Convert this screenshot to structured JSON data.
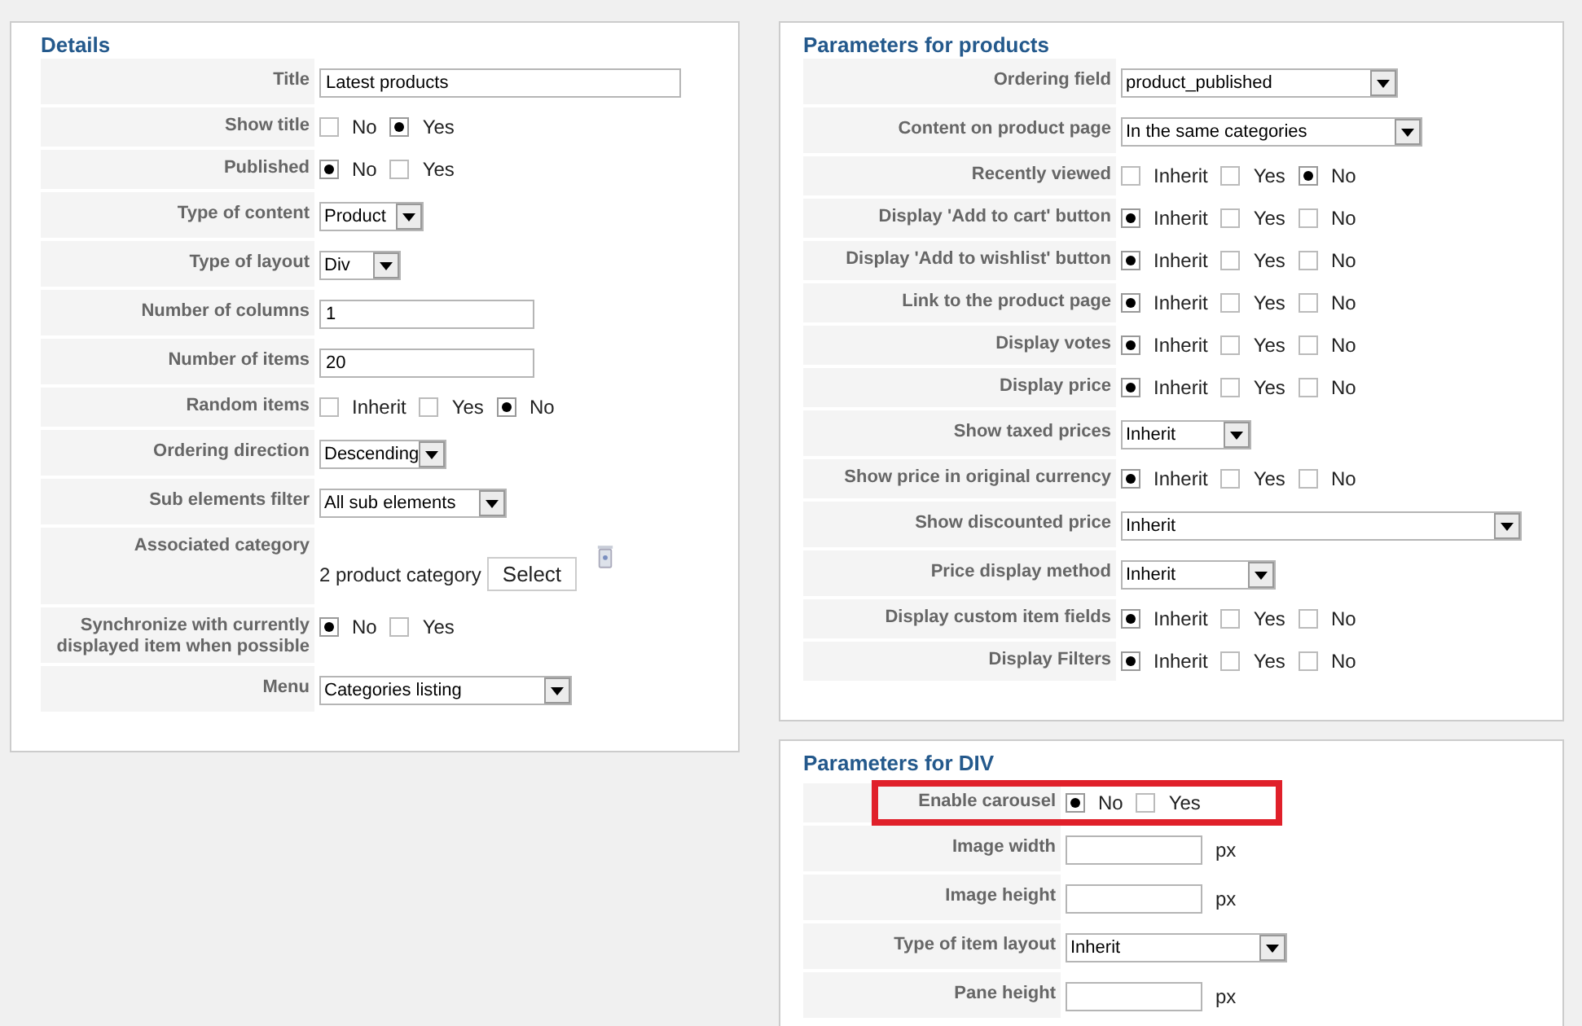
{
  "sections": [
    {
      "title": "Details",
      "rows": [
        {
          "kind": "text",
          "label": "Title",
          "value": "Latest products"
        },
        {
          "kind": "radio",
          "label": "Show title",
          "options": [
            {
              "label": "No",
              "selected": false
            },
            {
              "label": "Yes",
              "selected": true
            }
          ]
        },
        {
          "kind": "radio",
          "label": "Published",
          "options": [
            {
              "label": "No",
              "selected": true
            },
            {
              "label": "Yes",
              "selected": false
            }
          ]
        },
        {
          "kind": "select",
          "label": "Type of content",
          "value": "Product"
        },
        {
          "kind": "select",
          "label": "Type of layout",
          "value": "Div"
        },
        {
          "kind": "text",
          "label": "Number of columns",
          "value": "1"
        },
        {
          "kind": "text",
          "label": "Number of items",
          "value": "20"
        },
        {
          "kind": "radio",
          "label": "Random items",
          "options": [
            {
              "label": "Inherit",
              "selected": false
            },
            {
              "label": "Yes",
              "selected": false
            },
            {
              "label": "No",
              "selected": true
            }
          ]
        },
        {
          "kind": "select",
          "label": "Ordering direction",
          "value": "Descending"
        },
        {
          "kind": "select",
          "label": "Sub elements filter",
          "value": "All sub elements"
        },
        {
          "kind": "category",
          "label": "Associated category",
          "value": "2 product category",
          "button": "Select"
        },
        {
          "kind": "radio",
          "label": "Synchronize with currently displayed item when possible",
          "options": [
            {
              "label": "No",
              "selected": true
            },
            {
              "label": "Yes",
              "selected": false
            }
          ]
        },
        {
          "kind": "select",
          "label": "Menu",
          "value": "Categories listing"
        }
      ]
    },
    {
      "title": "Parameters for products",
      "rows": [
        {
          "kind": "select",
          "label": "Ordering field",
          "value": "product_published"
        },
        {
          "kind": "select",
          "label": "Content on product page",
          "value": "In the same categories"
        },
        {
          "kind": "radio",
          "label": "Recently viewed",
          "options": [
            {
              "label": "Inherit",
              "selected": false
            },
            {
              "label": "Yes",
              "selected": false
            },
            {
              "label": "No",
              "selected": true
            }
          ]
        },
        {
          "kind": "radio",
          "label": "Display 'Add to cart' button",
          "options": [
            {
              "label": "Inherit",
              "selected": true
            },
            {
              "label": "Yes",
              "selected": false
            },
            {
              "label": "No",
              "selected": false
            }
          ]
        },
        {
          "kind": "radio",
          "label": "Display 'Add to wishlist' button",
          "options": [
            {
              "label": "Inherit",
              "selected": true
            },
            {
              "label": "Yes",
              "selected": false
            },
            {
              "label": "No",
              "selected": false
            }
          ]
        },
        {
          "kind": "radio",
          "label": "Link to the product page",
          "options": [
            {
              "label": "Inherit",
              "selected": true
            },
            {
              "label": "Yes",
              "selected": false
            },
            {
              "label": "No",
              "selected": false
            }
          ]
        },
        {
          "kind": "radio",
          "label": "Display votes",
          "options": [
            {
              "label": "Inherit",
              "selected": true
            },
            {
              "label": "Yes",
              "selected": false
            },
            {
              "label": "No",
              "selected": false
            }
          ]
        },
        {
          "kind": "radio",
          "label": "Display price",
          "options": [
            {
              "label": "Inherit",
              "selected": true
            },
            {
              "label": "Yes",
              "selected": false
            },
            {
              "label": "No",
              "selected": false
            }
          ]
        },
        {
          "kind": "select",
          "label": "Show taxed prices",
          "value": "Inherit"
        },
        {
          "kind": "radio",
          "label": "Show price in original currency",
          "options": [
            {
              "label": "Inherit",
              "selected": true
            },
            {
              "label": "Yes",
              "selected": false
            },
            {
              "label": "No",
              "selected": false
            }
          ]
        },
        {
          "kind": "select",
          "label": "Show discounted price",
          "value": "Inherit"
        },
        {
          "kind": "select",
          "label": "Price display method",
          "value": "Inherit"
        },
        {
          "kind": "radio",
          "label": "Display custom item fields",
          "options": [
            {
              "label": "Inherit",
              "selected": true
            },
            {
              "label": "Yes",
              "selected": false
            },
            {
              "label": "No",
              "selected": false
            }
          ]
        },
        {
          "kind": "radio",
          "label": "Display Filters",
          "options": [
            {
              "label": "Inherit",
              "selected": true
            },
            {
              "label": "Yes",
              "selected": false
            },
            {
              "label": "No",
              "selected": false
            }
          ]
        }
      ]
    },
    {
      "title": "Parameters for DIV",
      "rows": [
        {
          "kind": "radio",
          "label": "Enable carousel",
          "highlighted": true,
          "options": [
            {
              "label": "No",
              "selected": true
            },
            {
              "label": "Yes",
              "selected": false
            }
          ]
        },
        {
          "kind": "text",
          "label": "Image width",
          "unit": "px"
        },
        {
          "kind": "text",
          "label": "Image height",
          "unit": "px"
        },
        {
          "kind": "select",
          "label": "Type of item layout",
          "value": "Inherit"
        },
        {
          "kind": "text",
          "label": "Pane height",
          "unit": "px"
        }
      ]
    }
  ]
}
